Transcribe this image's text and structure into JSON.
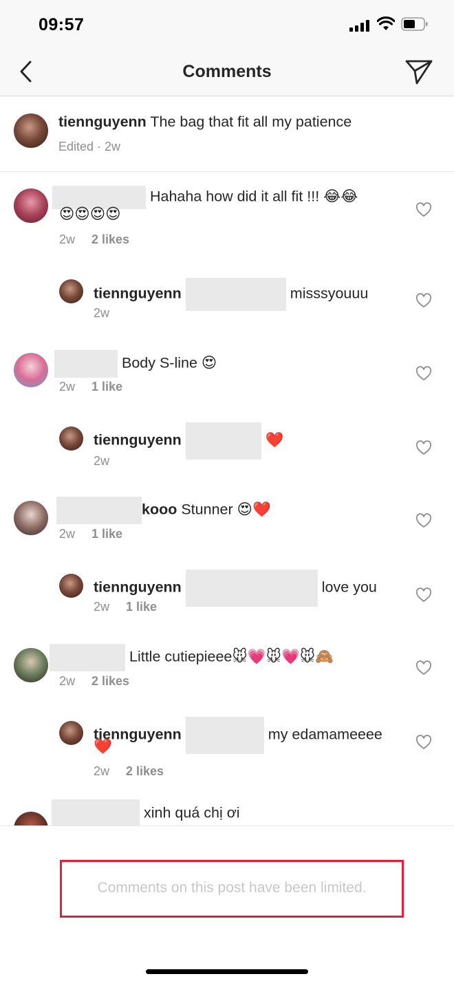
{
  "status_bar": {
    "time": "09:57"
  },
  "nav": {
    "title": "Comments"
  },
  "caption": {
    "username": "tiennguyenn",
    "text": "The bag that fit all my patience",
    "meta": "Edited · 2w"
  },
  "comments": [
    {
      "text": "Hahaha how did it all fit !!! 😂😂",
      "text2": "😍😍😍😍",
      "time": "2w",
      "likes": "2 likes"
    },
    {
      "username": "tiennguyenn",
      "text": "misssyouuu",
      "time": "2w"
    },
    {
      "text": "Body S-line 😍",
      "time": "2w",
      "likes": "1 like"
    },
    {
      "username": "tiennguyenn",
      "text": "❤️",
      "time": "2w"
    },
    {
      "username_partial": "kooo",
      "text": "Stunner 😍❤️",
      "time": "2w",
      "likes": "1 like"
    },
    {
      "username": "tiennguyenn",
      "text": "love you",
      "time": "2w",
      "likes": "1 like"
    },
    {
      "text": "Little cutiepieee🐭💗🐭💗🐭🙈",
      "time": "2w",
      "likes": "2 likes"
    },
    {
      "username": "tiennguyenn",
      "text": "my edamameeee",
      "text2": "❤️",
      "time": "2w",
      "likes": "2 likes"
    },
    {
      "text": "xinh quá chị ơi"
    }
  ],
  "footer": {
    "limited_message": "Comments on this post have been limited."
  },
  "colors": {
    "accent_border": "#e0203a",
    "muted": "#8e8e8e",
    "redaction": "#e9e9e9"
  },
  "icons": [
    "back-chevron-icon",
    "send-paper-plane-icon",
    "heart-outline-icon",
    "signal-icon",
    "wifi-icon",
    "battery-icon"
  ]
}
